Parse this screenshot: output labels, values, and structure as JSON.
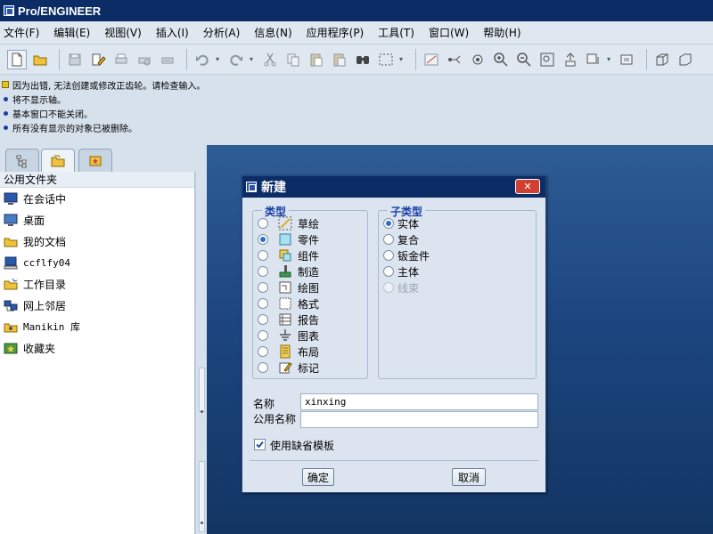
{
  "window": {
    "title": "Pro/ENGINEER"
  },
  "menu": [
    "文件(F)",
    "编辑(E)",
    "视图(V)",
    "插入(I)",
    "分析(A)",
    "信息(N)",
    "应用程序(P)",
    "工具(T)",
    "窗口(W)",
    "帮助(H)"
  ],
  "messages": [
    {
      "kind": "warning",
      "text": "因为出错, 无法创建或修改正齿轮。请检查输入。"
    },
    {
      "kind": "info",
      "text": "将不显示轴。"
    },
    {
      "kind": "info",
      "text": "基本窗口不能关闭。"
    },
    {
      "kind": "info",
      "text": "所有没有显示的对象已被删除。"
    }
  ],
  "navigator": {
    "header": "公用文件夹",
    "items": [
      {
        "label": "在会话中",
        "icon": "session-icon"
      },
      {
        "label": "桌面",
        "icon": "desktop-icon"
      },
      {
        "label": "我的文档",
        "icon": "documents-folder-icon"
      },
      {
        "label": "ccflfy04",
        "icon": "computer-icon"
      },
      {
        "label": "工作目录",
        "icon": "working-directory-icon"
      },
      {
        "label": "网上邻居",
        "icon": "network-icon"
      },
      {
        "label": "Manikin 库",
        "icon": "manikin-library-icon"
      },
      {
        "label": "收藏夹",
        "icon": "favorites-icon"
      }
    ]
  },
  "dialog": {
    "title": "新建",
    "close_label": "✕",
    "type_group": {
      "label": "类型",
      "selected": "零件",
      "options": [
        {
          "label": "草绘",
          "icon": "sketch-icon"
        },
        {
          "label": "零件",
          "icon": "part-icon"
        },
        {
          "label": "组件",
          "icon": "assembly-icon"
        },
        {
          "label": "制造",
          "icon": "manufacturing-icon"
        },
        {
          "label": "绘图",
          "icon": "drawing-icon"
        },
        {
          "label": "格式",
          "icon": "format-icon"
        },
        {
          "label": "报告",
          "icon": "report-icon"
        },
        {
          "label": "图表",
          "icon": "diagram-icon"
        },
        {
          "label": "布局",
          "icon": "layout-icon"
        },
        {
          "label": "标记",
          "icon": "markup-icon"
        }
      ]
    },
    "subtype_group": {
      "label": "子类型",
      "selected": "实体",
      "options": [
        {
          "label": "实体",
          "enabled": true
        },
        {
          "label": "复合",
          "enabled": true
        },
        {
          "label": "钣金件",
          "enabled": true
        },
        {
          "label": "主体",
          "enabled": true
        },
        {
          "label": "线束",
          "enabled": false
        }
      ]
    },
    "name_label": "名称",
    "name_value": "xinxing",
    "common_name_label": "公用名称",
    "common_name_value": "",
    "use_default_template_label": "使用缺省模板",
    "use_default_template_checked": true,
    "ok_label": "确定",
    "cancel_label": "取消"
  },
  "toolbar": {
    "buttons": [
      "new-file-icon",
      "open-folder-icon",
      "save-icon",
      "edit-icon",
      "print-icon",
      "print-preview-icon",
      "email-icon",
      "undo-icon",
      "redo-icon",
      "cut-icon",
      "copy-icon",
      "paste-icon",
      "paste-special-icon",
      "find-icon",
      "select-box-icon",
      "sketch-plane-icon",
      "datum-axis-icon",
      "regenerate-icon",
      "zoom-in-icon",
      "zoom-out-icon",
      "refit-icon",
      "reorient-icon",
      "saved-views-icon",
      "layers-icon",
      "display-style-icon",
      "wireframe-icon"
    ]
  },
  "colors": {
    "title_bar": "#0c2c66",
    "graphics_top": "#2e5c95",
    "graphics_bottom": "#123563",
    "accent": "#1a3fa6"
  }
}
